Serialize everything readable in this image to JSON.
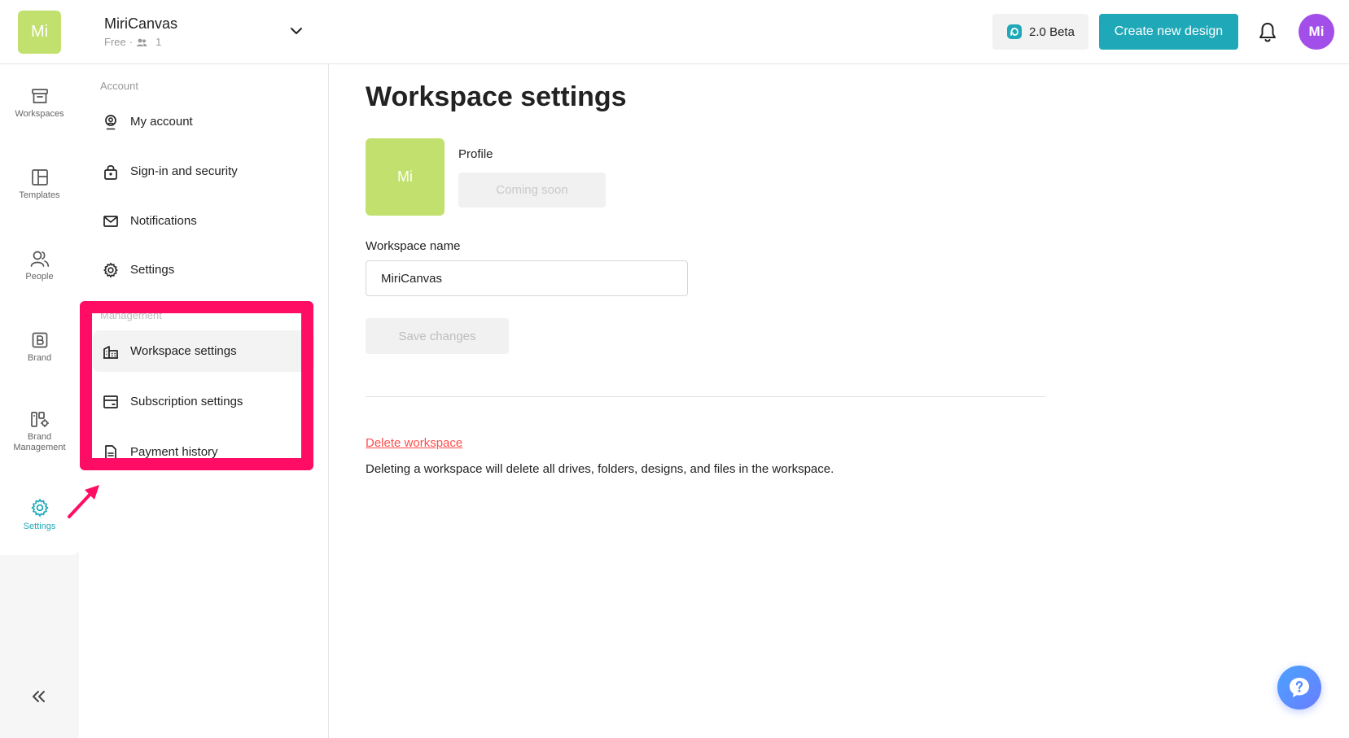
{
  "colors": {
    "brand_green": "#c2e06e",
    "accent_teal": "#1fa9b8",
    "avatar_purple": "#a24ee8",
    "highlight_pink": "#ff0d64",
    "danger_red": "#ff4d4d"
  },
  "header": {
    "workspace_initials": "Mi",
    "workspace_name": "MiriCanvas",
    "plan": "Free",
    "separator": "·",
    "member_count": "1",
    "beta_label": "2.0 Beta",
    "create_label": "Create new design",
    "avatar_initials": "Mi"
  },
  "rail": {
    "items": [
      {
        "label": "Workspaces",
        "icon": "archive-box-icon"
      },
      {
        "label": "Templates",
        "icon": "layout-icon"
      },
      {
        "label": "People",
        "icon": "people-icon"
      },
      {
        "label": "Brand",
        "icon": "brand-b-icon"
      },
      {
        "label": "Brand",
        "label2": "Management",
        "icon": "brand-management-icon"
      },
      {
        "label": "Settings",
        "icon": "gear-icon",
        "active": true
      }
    ]
  },
  "subnav": {
    "account_label": "Account",
    "account_items": [
      {
        "label": "My account",
        "icon": "person-badge-icon"
      },
      {
        "label": "Sign-in and security",
        "icon": "lock-icon"
      },
      {
        "label": "Notifications",
        "icon": "envelope-icon"
      },
      {
        "label": "Settings",
        "icon": "gear-icon"
      }
    ],
    "management_label": "Management",
    "management_items": [
      {
        "label": "Workspace settings",
        "icon": "building-icon",
        "active": true
      },
      {
        "label": "Subscription settings",
        "icon": "card-icon"
      },
      {
        "label": "Payment history",
        "icon": "document-icon"
      }
    ]
  },
  "main": {
    "title": "Workspace settings",
    "profile_initials": "Mi",
    "profile_label": "Profile",
    "coming_soon": "Coming soon",
    "name_label": "Workspace name",
    "name_value": "MiriCanvas",
    "save_label": "Save changes",
    "delete_label": "Delete workspace",
    "delete_desc": "Deleting a workspace will delete all drives, folders, designs, and files in the workspace."
  }
}
